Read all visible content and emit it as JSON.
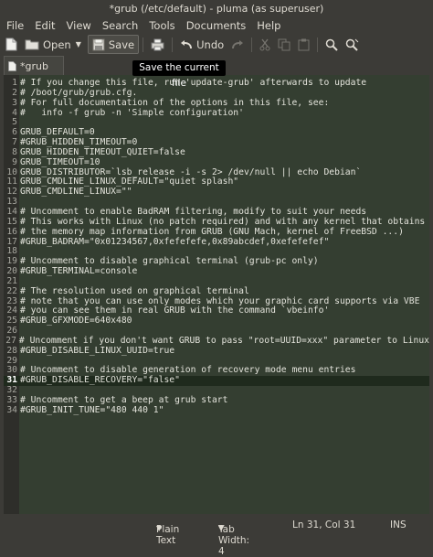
{
  "window": {
    "title": "*grub (/etc/default) - pluma (as superuser)"
  },
  "menu": [
    "File",
    "Edit",
    "View",
    "Search",
    "Tools",
    "Documents",
    "Help"
  ],
  "toolbar": {
    "open_label": "Open",
    "save_label": "Save",
    "undo_label": "Undo"
  },
  "tooltip": "Save the current file",
  "tab": {
    "label": "*grub"
  },
  "editor": {
    "current_line": 31,
    "lines": [
      "# If you change this file, run 'update-grub' afterwards to update",
      "# /boot/grub/grub.cfg.",
      "# For full documentation of the options in this file, see:",
      "#   info -f grub -n 'Simple configuration'",
      "",
      "GRUB_DEFAULT=0",
      "#GRUB_HIDDEN_TIMEOUT=0",
      "GRUB_HIDDEN_TIMEOUT_QUIET=false",
      "GRUB_TIMEOUT=10",
      "GRUB_DISTRIBUTOR=`lsb_release -i -s 2> /dev/null || echo Debian`",
      "GRUB_CMDLINE_LINUX_DEFAULT=\"quiet splash\"",
      "GRUB_CMDLINE_LINUX=\"\"",
      "",
      "# Uncomment to enable BadRAM filtering, modify to suit your needs",
      "# This works with Linux (no patch required) and with any kernel that obtains",
      "# the memory map information from GRUB (GNU Mach, kernel of FreeBSD ...)",
      "#GRUB_BADRAM=\"0x01234567,0xfefefefe,0x89abcdef,0xefefefef\"",
      "",
      "# Uncomment to disable graphical terminal (grub-pc only)",
      "#GRUB_TERMINAL=console",
      "",
      "# The resolution used on graphical terminal",
      "# note that you can use only modes which your graphic card supports via VBE",
      "# you can see them in real GRUB with the command `vbeinfo'",
      "#GRUB_GFXMODE=640x480",
      "",
      "# Uncomment if you don't want GRUB to pass \"root=UUID=xxx\" parameter to Linux",
      "#GRUB_DISABLE_LINUX_UUID=true",
      "",
      "# Uncomment to disable generation of recovery mode menu entries",
      "#GRUB_DISABLE_RECOVERY=\"false\"",
      "",
      "# Uncomment to get a beep at grub start",
      "#GRUB_INIT_TUNE=\"480 440 1\""
    ]
  },
  "status": {
    "syntax": "Plain Text",
    "tab_width": "Tab Width: 4",
    "position": "Ln 31, Col 31",
    "mode": "INS"
  }
}
